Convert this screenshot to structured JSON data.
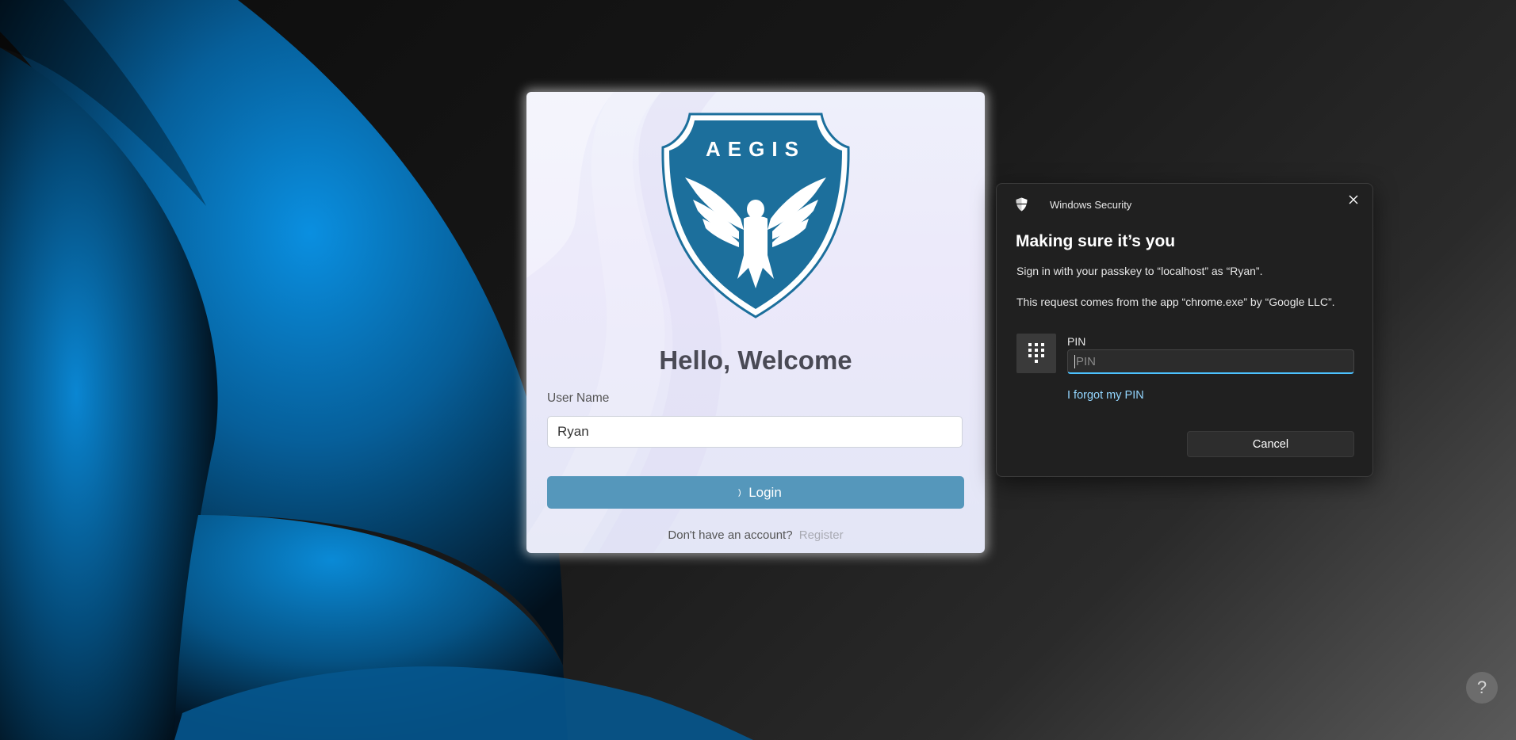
{
  "login_card": {
    "logo_text": "AEGIS",
    "welcome": "Hello, Welcome",
    "username_label": "User Name",
    "username_value": "Ryan",
    "login_button": "Login",
    "no_account_text": "Don't have an account?",
    "register_link": "Register"
  },
  "security_dialog": {
    "app_name": "Windows Security",
    "title": "Making sure it’s you",
    "line1": "Sign in with your passkey to “localhost” as “Ryan”.",
    "line2": "This request comes from the app “chrome.exe” by “Google LLC”.",
    "pin_label": "PIN",
    "pin_placeholder": "PIN",
    "forgot_pin": "I forgot my PIN",
    "cancel_button": "Cancel"
  },
  "help_button": {
    "label": "?"
  },
  "colors": {
    "accent_blue": "#5597bb",
    "dialog_bg": "#202020",
    "link_blue": "#93d6ff",
    "logo_blue": "#1c6f9c"
  }
}
